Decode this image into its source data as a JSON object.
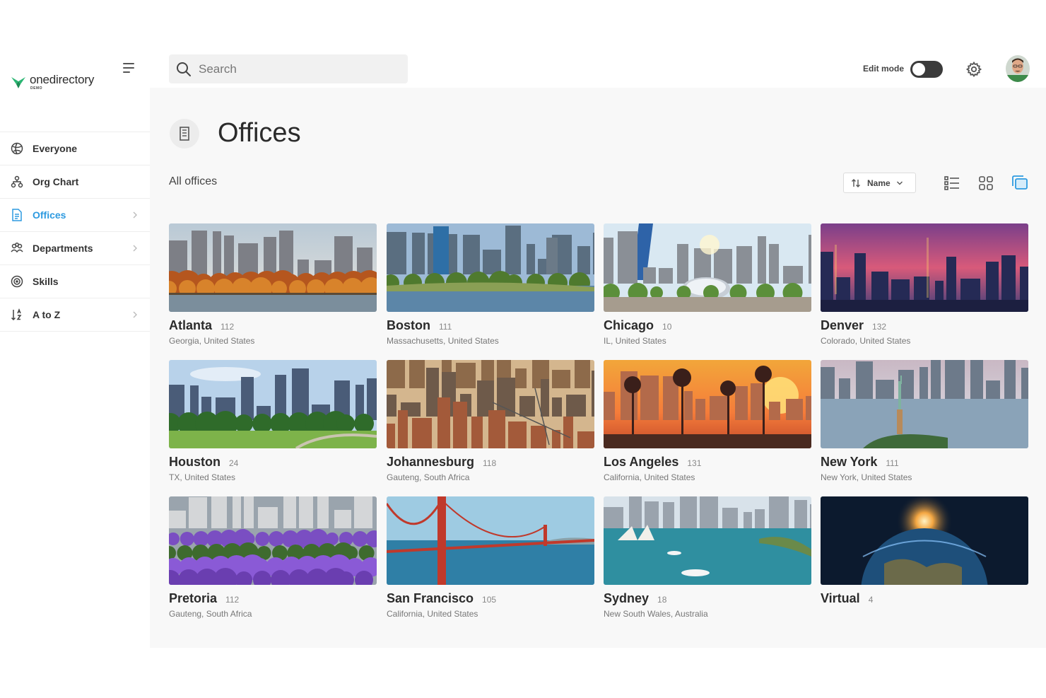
{
  "app": {
    "brand_name": "onedirectory",
    "brand_sub": "DEMO",
    "brand_color": "#2d9ae0"
  },
  "sidebar": {
    "items": [
      {
        "label": "Everyone",
        "icon": "globe-icon",
        "active": false,
        "has_chevron": false
      },
      {
        "label": "Org Chart",
        "icon": "org-chart-icon",
        "active": false,
        "has_chevron": false
      },
      {
        "label": "Offices",
        "icon": "building-icon",
        "active": true,
        "has_chevron": true
      },
      {
        "label": "Departments",
        "icon": "departments-icon",
        "active": false,
        "has_chevron": true
      },
      {
        "label": "Skills",
        "icon": "skills-icon",
        "active": false,
        "has_chevron": false
      },
      {
        "label": "A to Z",
        "icon": "sort-az-icon",
        "active": false,
        "has_chevron": true
      }
    ]
  },
  "topbar": {
    "search_placeholder": "Search",
    "edit_mode_label": "Edit mode",
    "edit_mode_on": false
  },
  "main": {
    "title": "Offices",
    "subtitle": "All offices",
    "sort_label": "Name",
    "active_view": "card-view"
  },
  "offices": [
    {
      "name": "Atlanta",
      "count": "112",
      "location": "Georgia, United States",
      "scene": "autumn-skyline"
    },
    {
      "name": "Boston",
      "count": "111",
      "location": "Massachusetts, United States",
      "scene": "river-skyline"
    },
    {
      "name": "Chicago",
      "count": "10",
      "location": "IL, United States",
      "scene": "plaza-skyline"
    },
    {
      "name": "Denver",
      "count": "132",
      "location": "Colorado, United States",
      "scene": "dusk-skyline"
    },
    {
      "name": "Houston",
      "count": "24",
      "location": "TX, United States",
      "scene": "park-skyline"
    },
    {
      "name": "Johannesburg",
      "count": "118",
      "location": "Gauteng, South Africa",
      "scene": "dense-city"
    },
    {
      "name": "Los Angeles",
      "count": "131",
      "location": "California, United States",
      "scene": "sunset-palms"
    },
    {
      "name": "New York",
      "count": "111",
      "location": "New York, United States",
      "scene": "harbor-statue"
    },
    {
      "name": "Pretoria",
      "count": "112",
      "location": "Gauteng, South Africa",
      "scene": "jacaranda-city"
    },
    {
      "name": "San Francisco",
      "count": "105",
      "location": "California, United States",
      "scene": "golden-gate"
    },
    {
      "name": "Sydney",
      "count": "18",
      "location": "New South Wales, Australia",
      "scene": "harbor-opera"
    },
    {
      "name": "Virtual",
      "count": "4",
      "location": "",
      "scene": "earth-space"
    }
  ]
}
